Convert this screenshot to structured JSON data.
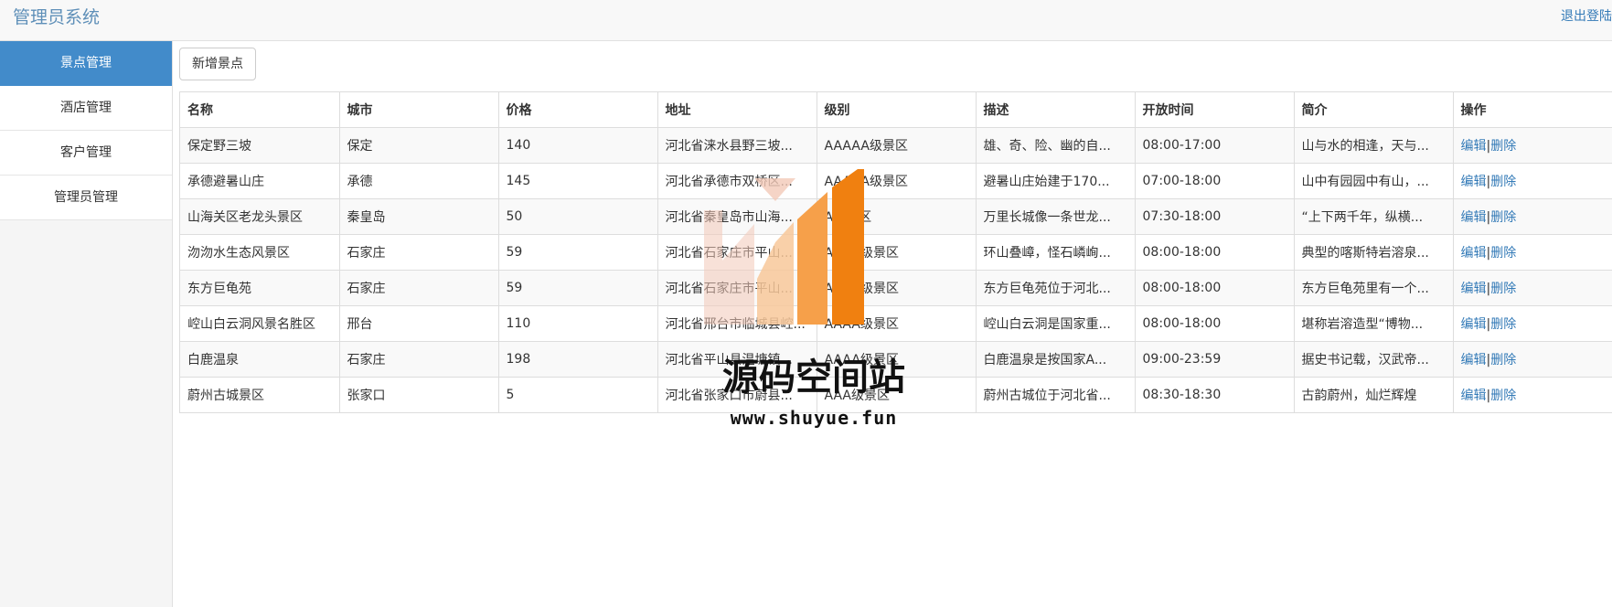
{
  "header": {
    "title": "管理员系统",
    "logout": "退出登陆"
  },
  "sidebar": {
    "items": [
      {
        "label": "景点管理",
        "active": true
      },
      {
        "label": "酒店管理",
        "active": false
      },
      {
        "label": "客户管理",
        "active": false
      },
      {
        "label": "管理员管理",
        "active": false
      }
    ]
  },
  "toolbar": {
    "add_label": "新增景点"
  },
  "table": {
    "columns": [
      "名称",
      "城市",
      "价格",
      "地址",
      "级别",
      "描述",
      "开放时间",
      "简介",
      "操作"
    ],
    "rows": [
      [
        "保定野三坡",
        "保定",
        "140",
        "河北省涞水县野三坡...",
        "AAAAA级景区",
        "雄、奇、险、幽的自...",
        "08:00-17:00",
        "山与水的相逢，天与..."
      ],
      [
        "承德避暑山庄",
        "承德",
        "145",
        "河北省承德市双桥区...",
        "AAAAA级景区",
        "避暑山庄始建于170...",
        "07:00-18:00",
        "山中有园园中有山，..."
      ],
      [
        "山海关区老龙头景区",
        "秦皇岛",
        "50",
        "河北省秦皇岛市山海...",
        "A级景区",
        "万里长城像一条世龙...",
        "07:30-18:00",
        "“上下两千年，纵横..."
      ],
      [
        "沕沕水生态风景区",
        "石家庄",
        "59",
        "河北省石家庄市平山...",
        "AAAA级景区",
        "环山叠嶂，怪石嶙峋...",
        "08:00-18:00",
        "典型的喀斯特岩溶泉..."
      ],
      [
        "东方巨龟苑",
        "石家庄",
        "59",
        "河北省石家庄市平山...",
        "AAAA级景区",
        "东方巨龟苑位于河北...",
        "08:00-18:00",
        "东方巨龟苑里有一个..."
      ],
      [
        "崆山白云洞风景名胜区",
        "邢台",
        "110",
        "河北省邢台市临城县崆...",
        "AAAA级景区",
        "崆山白云洞是国家重...",
        "08:00-18:00",
        "堪称岩溶造型“博物..."
      ],
      [
        "白鹿温泉",
        "石家庄",
        "198",
        "河北省平山县温塘镇...",
        "AAAA级景区",
        "白鹿温泉是按国家A...",
        "09:00-23:59",
        "据史书记载，汉武帝..."
      ],
      [
        "蔚州古城景区",
        "张家口",
        "5",
        "河北省张家口市蔚县...",
        "AAA级景区",
        "蔚州古城位于河北省...",
        "08:30-18:30",
        "古韵蔚州，灿烂辉煌"
      ]
    ],
    "actions": {
      "edit": "编辑",
      "separator": "|",
      "delete": "删除"
    }
  },
  "watermark": {
    "text": "源码空间站",
    "url": "www.shuyue.fun",
    "colors": {
      "bar_light": "#f3c9b8",
      "bar_mid": "#f6a04a",
      "bar_dark": "#f08010"
    }
  }
}
